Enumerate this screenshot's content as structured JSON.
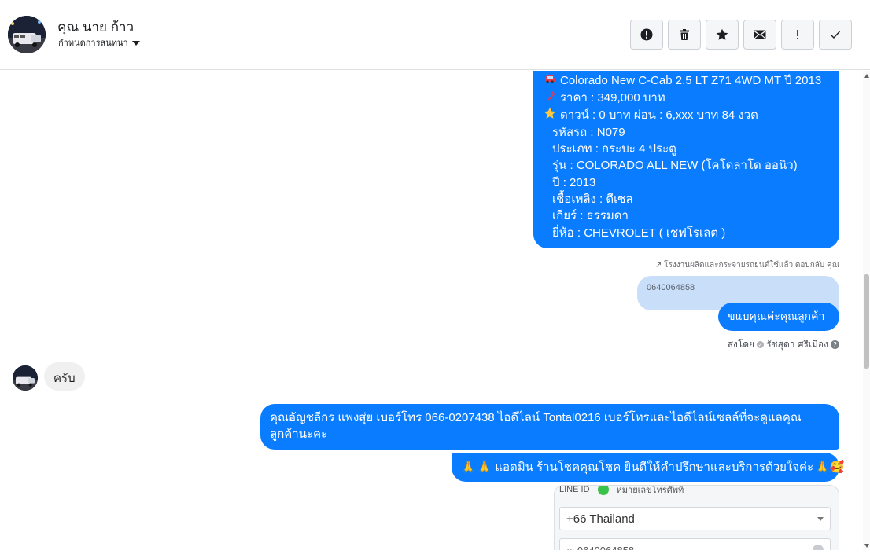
{
  "header": {
    "contact_name": "คุณ นาย ก้าว",
    "conversation_label": "กำหนดการสนทนา"
  },
  "actions": [
    "report",
    "delete",
    "star",
    "email",
    "important",
    "done"
  ],
  "car_listing": {
    "title": "Colorado New C-Cab 2.5 LT Z71 4WD MT ปี 2013",
    "price": "ราคา : 349,000 บาท",
    "down": "ดาวน์ : 0 บาท ผ่อน : 6,xxx  บาท 84 งวด",
    "code": "รหัสรถ : N079",
    "type": "ประเภท : กระบะ 4 ประตู",
    "model": "รุ่น : COLORADO ALL NEW (โคโดลาโด ออนิว)",
    "year": "ปี : 2013",
    "fuel": "เชื้อเพลิง : ดีเซล",
    "gear": "เกียร์ : ธรรมดา",
    "brand": "ยี่ห้อ : CHEVROLET ( เชฟโรเลต )"
  },
  "reply_note": "โรงงานผลิตและกระจายรถยนต์ใช้แล้ว ตอบกลับ คุณ",
  "quoted_text": "0640064858",
  "thanks_message": "ขแบคุณค่ะคุณลูกค้า",
  "sent_by": "ส่งโดย",
  "sender_name": "รัชสุดา ศรีเมือง",
  "incoming_message": "ครับ",
  "agent_message": "คุณอัญชลีกร แพงสุ่ย      เบอร์โทร 066-0207438 ไอดีไลน์ Tontal0216   เบอร์โทรและไอดีไลน์เซลล์ที่จะดูแลคุณลูกค้านะคะ",
  "welcome_message": "แอดมิน ร้านโชคคุณโชค ยินดีให้คำปรึกษาและบริการด้วยใจค่ะ",
  "screenshot": {
    "top_label": "LINE ID",
    "top_right_label": "หมายเลขโทรศัพท์",
    "country_value": "+66  Thailand",
    "phone_value": "0640064858"
  }
}
